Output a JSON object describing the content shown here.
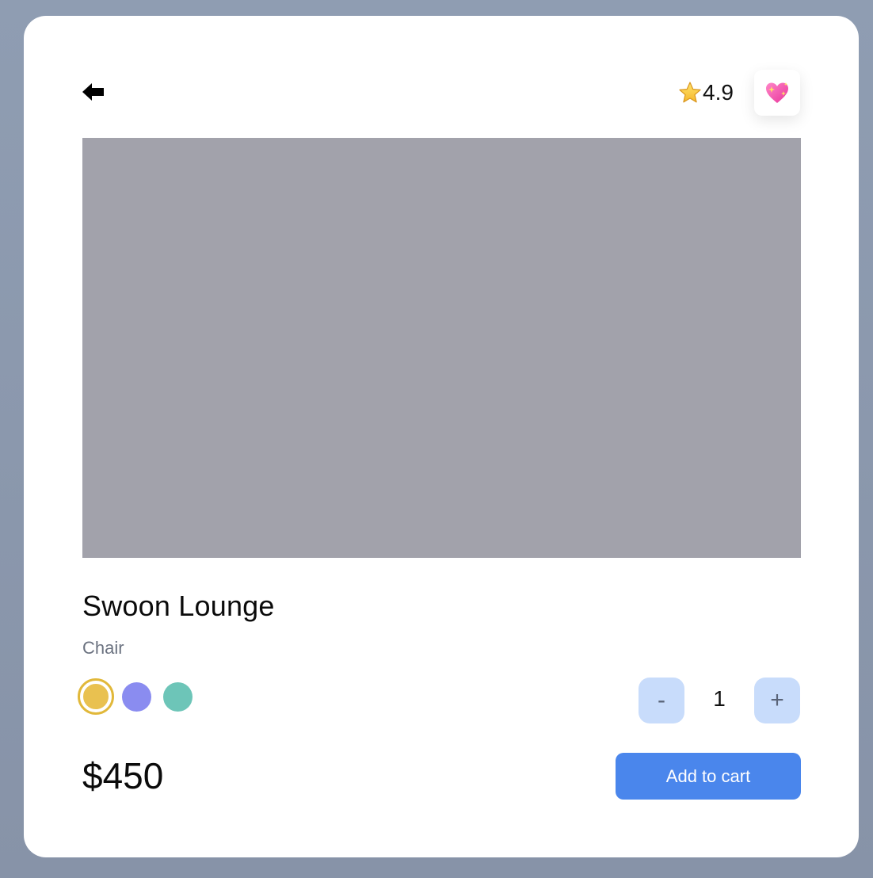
{
  "header": {
    "back_icon": "arrow-left-icon",
    "rating_icon": "star-icon",
    "rating_value": "4.9",
    "favorite_icon": "sparkling-heart-icon"
  },
  "product": {
    "name": "Swoon Lounge",
    "category": "Chair",
    "price": "$450",
    "colors": [
      {
        "name": "yellow",
        "hex": "#e9c150",
        "selected": true
      },
      {
        "name": "purple",
        "hex": "#8a8cf0",
        "selected": false
      },
      {
        "name": "teal",
        "hex": "#6dc5b8",
        "selected": false
      }
    ],
    "image_placeholder_color": "#a2a2ab"
  },
  "quantity": {
    "minus_label": "-",
    "value": "1",
    "plus_label": "+"
  },
  "actions": {
    "add_to_cart_label": "Add to cart",
    "accent_color": "#4a86ec"
  }
}
